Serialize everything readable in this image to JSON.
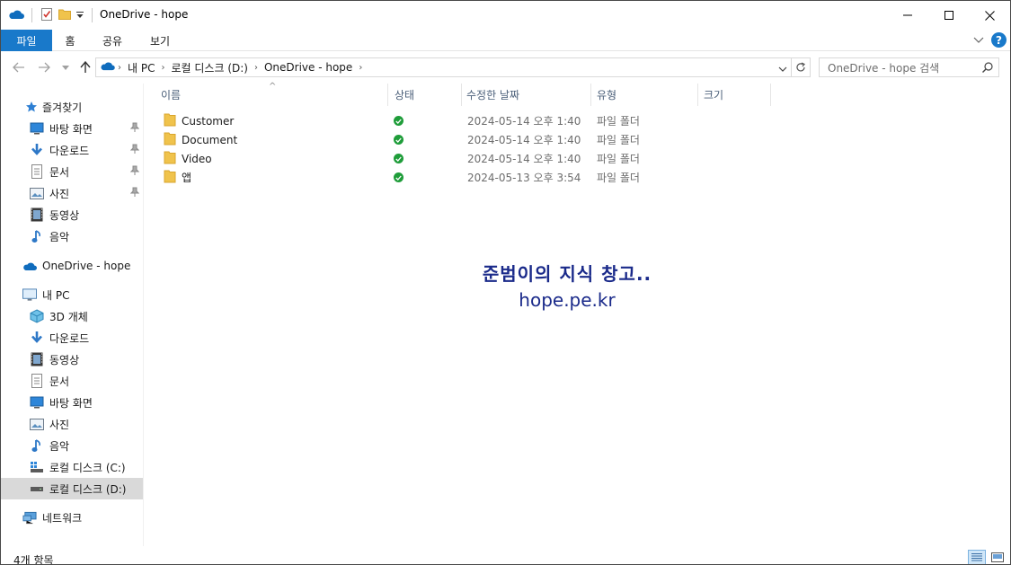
{
  "window": {
    "title": "OneDrive - hope",
    "buttons": {
      "minimize": "—",
      "maximize": "☐",
      "close": "✕"
    }
  },
  "ribbon": {
    "tabs": [
      "파일",
      "홈",
      "공유",
      "보기"
    ],
    "help": "?"
  },
  "address": {
    "crumbs": [
      "내 PC",
      "로컬 디스크 (D:)",
      "OneDrive - hope"
    ],
    "search_placeholder": "OneDrive - hope 검색"
  },
  "nav": {
    "quick_access": "즐겨찾기",
    "quick_items": [
      "바탕 화면",
      "다운로드",
      "문서",
      "사진",
      "동영상",
      "음악"
    ],
    "onedrive": "OneDrive - hope",
    "this_pc": "내 PC",
    "pc_items": [
      "3D 개체",
      "다운로드",
      "동영상",
      "문서",
      "바탕 화면",
      "사진",
      "음악",
      "로컬 디스크 (C:)",
      "로컬 디스크 (D:)"
    ],
    "network": "네트워크"
  },
  "columns": [
    "이름",
    "상태",
    "수정한 날짜",
    "유형",
    "크기"
  ],
  "files": [
    {
      "name": "Customer",
      "date": "2024-05-14 오후 1:40",
      "type": "파일 폴더"
    },
    {
      "name": "Document",
      "date": "2024-05-14 오후 1:40",
      "type": "파일 폴더"
    },
    {
      "name": "Video",
      "date": "2024-05-14 오후 1:40",
      "type": "파일 폴더"
    },
    {
      "name": "앱",
      "date": "2024-05-13 오후 3:54",
      "type": "파일 폴더"
    }
  ],
  "watermark": {
    "line1": "준범이의 지식 창고..",
    "line2": "hope.pe.kr"
  },
  "status": {
    "count": "4개 항목"
  },
  "colors": {
    "accent": "#1979ca",
    "folder": "#f0c34c",
    "sync_ok": "#1f9d3a",
    "watermark": "#1a2a8a"
  }
}
